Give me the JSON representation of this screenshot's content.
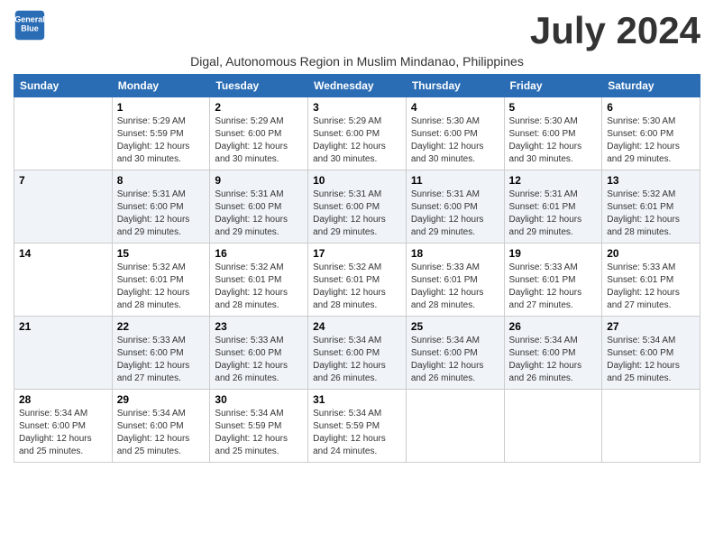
{
  "logo": {
    "line1": "General",
    "line2": "Blue"
  },
  "month_title": "July 2024",
  "subtitle": "Digal, Autonomous Region in Muslim Mindanao, Philippines",
  "weekdays": [
    "Sunday",
    "Monday",
    "Tuesday",
    "Wednesday",
    "Thursday",
    "Friday",
    "Saturday"
  ],
  "weeks": [
    [
      {
        "day": "",
        "info": ""
      },
      {
        "day": "1",
        "info": "Sunrise: 5:29 AM\nSunset: 5:59 PM\nDaylight: 12 hours\nand 30 minutes."
      },
      {
        "day": "2",
        "info": "Sunrise: 5:29 AM\nSunset: 6:00 PM\nDaylight: 12 hours\nand 30 minutes."
      },
      {
        "day": "3",
        "info": "Sunrise: 5:29 AM\nSunset: 6:00 PM\nDaylight: 12 hours\nand 30 minutes."
      },
      {
        "day": "4",
        "info": "Sunrise: 5:30 AM\nSunset: 6:00 PM\nDaylight: 12 hours\nand 30 minutes."
      },
      {
        "day": "5",
        "info": "Sunrise: 5:30 AM\nSunset: 6:00 PM\nDaylight: 12 hours\nand 30 minutes."
      },
      {
        "day": "6",
        "info": "Sunrise: 5:30 AM\nSunset: 6:00 PM\nDaylight: 12 hours\nand 29 minutes."
      }
    ],
    [
      {
        "day": "7",
        "info": ""
      },
      {
        "day": "8",
        "info": "Sunrise: 5:31 AM\nSunset: 6:00 PM\nDaylight: 12 hours\nand 29 minutes."
      },
      {
        "day": "9",
        "info": "Sunrise: 5:31 AM\nSunset: 6:00 PM\nDaylight: 12 hours\nand 29 minutes."
      },
      {
        "day": "10",
        "info": "Sunrise: 5:31 AM\nSunset: 6:00 PM\nDaylight: 12 hours\nand 29 minutes."
      },
      {
        "day": "11",
        "info": "Sunrise: 5:31 AM\nSunset: 6:00 PM\nDaylight: 12 hours\nand 29 minutes."
      },
      {
        "day": "12",
        "info": "Sunrise: 5:31 AM\nSunset: 6:01 PM\nDaylight: 12 hours\nand 29 minutes."
      },
      {
        "day": "13",
        "info": "Sunrise: 5:32 AM\nSunset: 6:01 PM\nDaylight: 12 hours\nand 28 minutes."
      }
    ],
    [
      {
        "day": "14",
        "info": ""
      },
      {
        "day": "15",
        "info": "Sunrise: 5:32 AM\nSunset: 6:01 PM\nDaylight: 12 hours\nand 28 minutes."
      },
      {
        "day": "16",
        "info": "Sunrise: 5:32 AM\nSunset: 6:01 PM\nDaylight: 12 hours\nand 28 minutes."
      },
      {
        "day": "17",
        "info": "Sunrise: 5:32 AM\nSunset: 6:01 PM\nDaylight: 12 hours\nand 28 minutes."
      },
      {
        "day": "18",
        "info": "Sunrise: 5:33 AM\nSunset: 6:01 PM\nDaylight: 12 hours\nand 28 minutes."
      },
      {
        "day": "19",
        "info": "Sunrise: 5:33 AM\nSunset: 6:01 PM\nDaylight: 12 hours\nand 27 minutes."
      },
      {
        "day": "20",
        "info": "Sunrise: 5:33 AM\nSunset: 6:01 PM\nDaylight: 12 hours\nand 27 minutes."
      }
    ],
    [
      {
        "day": "21",
        "info": ""
      },
      {
        "day": "22",
        "info": "Sunrise: 5:33 AM\nSunset: 6:00 PM\nDaylight: 12 hours\nand 27 minutes."
      },
      {
        "day": "23",
        "info": "Sunrise: 5:33 AM\nSunset: 6:00 PM\nDaylight: 12 hours\nand 26 minutes."
      },
      {
        "day": "24",
        "info": "Sunrise: 5:34 AM\nSunset: 6:00 PM\nDaylight: 12 hours\nand 26 minutes."
      },
      {
        "day": "25",
        "info": "Sunrise: 5:34 AM\nSunset: 6:00 PM\nDaylight: 12 hours\nand 26 minutes."
      },
      {
        "day": "26",
        "info": "Sunrise: 5:34 AM\nSunset: 6:00 PM\nDaylight: 12 hours\nand 26 minutes."
      },
      {
        "day": "27",
        "info": "Sunrise: 5:34 AM\nSunset: 6:00 PM\nDaylight: 12 hours\nand 25 minutes."
      }
    ],
    [
      {
        "day": "28",
        "info": "Sunrise: 5:34 AM\nSunset: 6:00 PM\nDaylight: 12 hours\nand 25 minutes."
      },
      {
        "day": "29",
        "info": "Sunrise: 5:34 AM\nSunset: 6:00 PM\nDaylight: 12 hours\nand 25 minutes."
      },
      {
        "day": "30",
        "info": "Sunrise: 5:34 AM\nSunset: 5:59 PM\nDaylight: 12 hours\nand 25 minutes."
      },
      {
        "day": "31",
        "info": "Sunrise: 5:34 AM\nSunset: 5:59 PM\nDaylight: 12 hours\nand 24 minutes."
      },
      {
        "day": "",
        "info": ""
      },
      {
        "day": "",
        "info": ""
      },
      {
        "day": "",
        "info": ""
      }
    ]
  ]
}
